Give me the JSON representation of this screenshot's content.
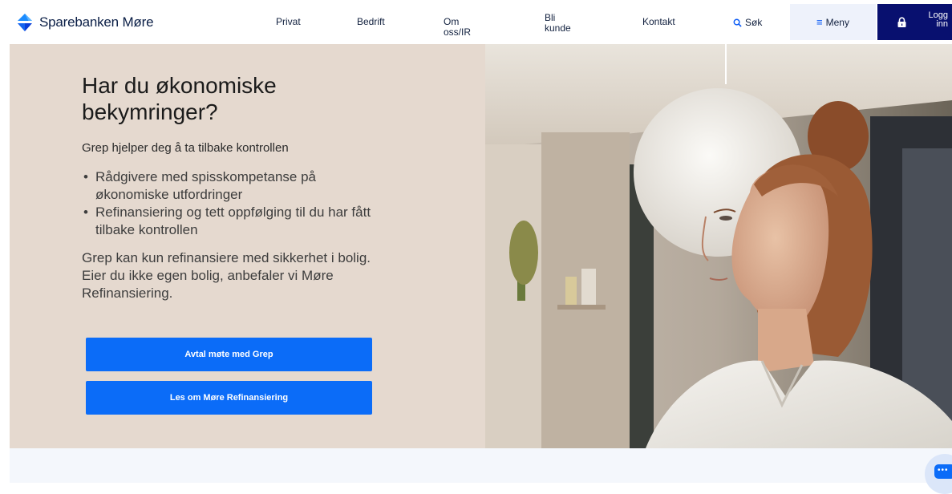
{
  "header": {
    "brand": "Sparebanken Møre",
    "nav": [
      "Privat",
      "Bedrift",
      "Om\noss/IR",
      "Bli\nkunde",
      "Kontakt"
    ],
    "search_label": "Søk",
    "menu_label": "Meny",
    "login_label": "Logg\ninn"
  },
  "hero": {
    "title": "Har du økonomiske\nbekymringer?",
    "subtitle": "Grep hjelper deg å ta tilbake kontrollen",
    "bullets": [
      "Rådgivere med spisskompetanse på økonomiske utfordringer",
      "Refinansiering og tett oppfølging til du har fått tilbake kontrollen"
    ],
    "body": "Grep kan kun refinansiere med sikkerhet i bolig. Eier du ikke egen bolig, anbefaler vi Møre Refinansiering.",
    "cta_primary": "Avtal møte med Grep",
    "cta_secondary": "Les om Møre Refinansiering"
  },
  "colors": {
    "brand_blue": "#0b6cf8",
    "dark_navy": "#08106f",
    "hero_beige": "#e5d9cf"
  },
  "icons": {
    "logo": "sparebanken-diamond-logo",
    "search": "search-icon",
    "menu": "hamburger-icon",
    "login": "lock-icon",
    "chat": "chat-icon"
  }
}
